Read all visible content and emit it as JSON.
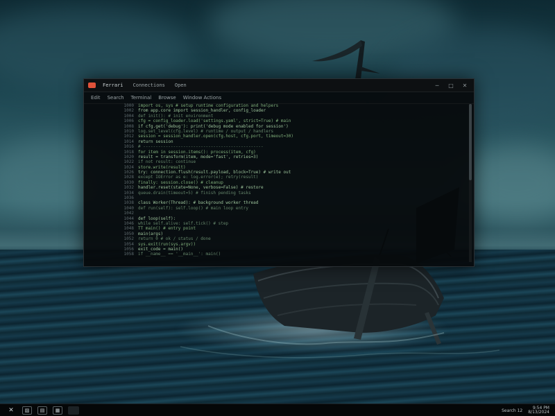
{
  "window": {
    "tabs": [
      {
        "label": "Ferrari",
        "active": true
      },
      {
        "label": "Connections",
        "active": false
      },
      {
        "label": "Open",
        "active": false
      }
    ],
    "controls": {
      "minimize": "─",
      "maximize": "□",
      "close": "✕"
    }
  },
  "menu": {
    "items": [
      "Edit",
      "Search",
      "Terminal",
      "Browse",
      "Window Actions"
    ]
  },
  "editor": {
    "lines": [
      {
        "n": "1000",
        "t": "  import os, sys   # setup runtime configuration and helpers"
      },
      {
        "n": "1002",
        "t": "  from app.core import session_handler, config_loader"
      },
      {
        "n": "1004",
        "t": "  def init():       # init environment"
      },
      {
        "n": "1006",
        "t": "    cfg = config_loader.load('settings.yaml', strict=True)  # main"
      },
      {
        "n": "1008",
        "t": "    if cfg.get('debug'):  print('debug mode enabled for session')"
      },
      {
        "n": "1010",
        "t": "      log.set_level(cfg.level)   # runtime / output / handlers"
      },
      {
        "n": "1012",
        "t": "    session = session_handler.open(cfg.host, cfg.port, timeout=30)"
      },
      {
        "n": "1014",
        "t": "      return session"
      },
      {
        "n": "1016",
        "t": "    # ------------------------------------------------"
      },
      {
        "n": "1018",
        "t": "          for item in session.items(): process(item, cfg)"
      },
      {
        "n": "1020",
        "t": "            result = transform(item, mode='fast', retries=3)"
      },
      {
        "n": "1022",
        "t": "      if not result:  continue"
      },
      {
        "n": "1024",
        "t": "    store.write(result)"
      },
      {
        "n": "1026",
        "t": "    try:  connection.flush(result.payload, block=True)  # write out"
      },
      {
        "n": "1028",
        "t": "      except IOError as e:  log.error(e); retry(result)"
      },
      {
        "n": "1030",
        "t": "    finally:  session.close()   # cleanup"
      },
      {
        "n": "1032",
        "t": "      handler.reset(state=None, verbose=False)  # restore"
      },
      {
        "n": "1034",
        "t": "        queue.drain(timeout=5)  # finish pending tasks"
      },
      {
        "n": "1036",
        "t": ""
      },
      {
        "n": "1038",
        "t": "  class Worker(Thread):   # background worker thread"
      },
      {
        "n": "1040",
        "t": "    def run(self):   self.loop()   # main loop entry"
      },
      {
        "n": "1042",
        "t": ""
      },
      {
        "n": "1044",
        "t": "      def loop(self):"
      },
      {
        "n": "1046",
        "t": "        while self.alive:  self.tick()   # step"
      },
      {
        "n": "1048",
        "t": "    TT    main()  # entry point"
      },
      {
        "n": "1050",
        "t": "  main(args)"
      },
      {
        "n": "1052",
        "t": "    return 0   # ok / status / done"
      },
      {
        "n": "1054",
        "t": "      sys.exit(run(sys.argv))"
      },
      {
        "n": "1056",
        "t": "  exit_code = main()"
      },
      {
        "n": "1058",
        "t": "  if __name__ == '__main__':  main()"
      }
    ]
  },
  "taskbar": {
    "icons": [
      "close-x-icon",
      "image-icon",
      "folder-icon",
      "picture-icon",
      "blank-app-icon"
    ],
    "tray_label": "Search 12",
    "time": "9:54 PM",
    "date": "8/13/2024"
  },
  "colors": {
    "code": "#7fae7a",
    "gutter": "#5e6a6e",
    "accent": "#e0523a"
  }
}
